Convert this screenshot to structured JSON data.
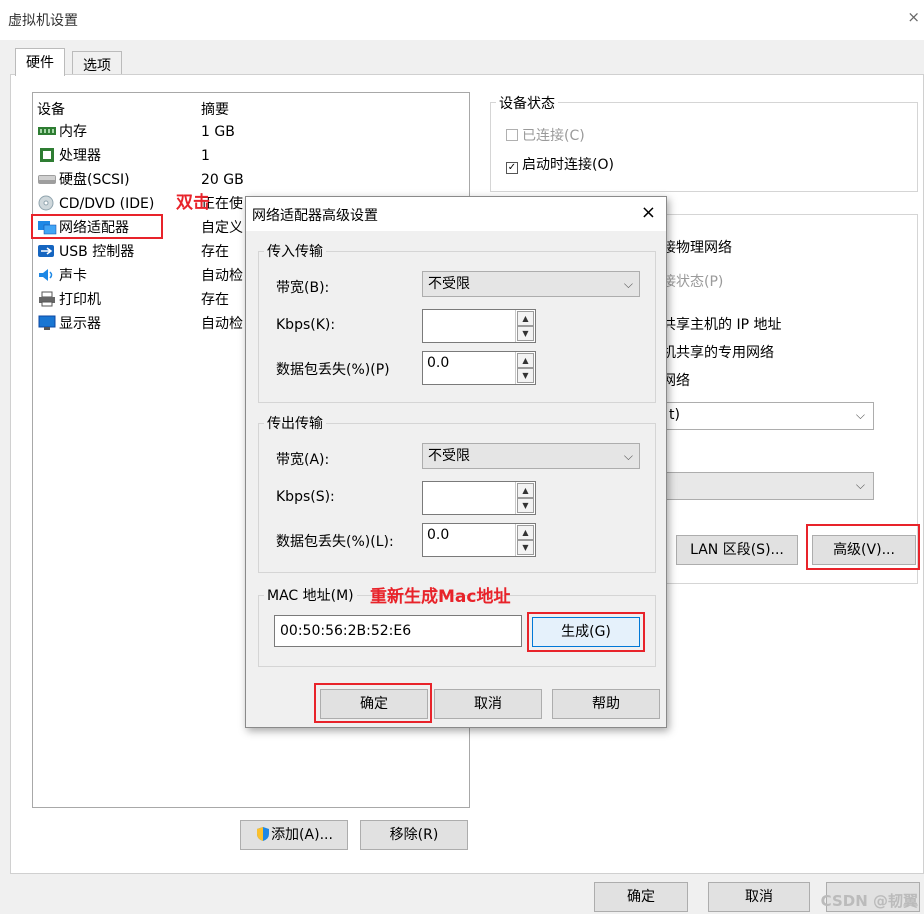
{
  "window": {
    "title": "虚拟机设置",
    "close_glyph": "×"
  },
  "tabs": [
    {
      "label": "硬件",
      "active": true
    },
    {
      "label": "选项",
      "active": false
    }
  ],
  "device_list": {
    "col_device": "设备",
    "col_summary": "摘要",
    "items": [
      {
        "name": "内存",
        "summary": "1 GB",
        "icon": "memory-icon"
      },
      {
        "name": "处理器",
        "summary": "1",
        "icon": "cpu-icon"
      },
      {
        "name": "硬盘(SCSI)",
        "summary": "20 GB",
        "icon": "harddisk-icon"
      },
      {
        "name": "CD/DVD (IDE)",
        "summary": "正在使",
        "icon": "cdrom-icon"
      },
      {
        "name": "网络适配器",
        "summary": "自定义",
        "icon": "network-icon"
      },
      {
        "name": "USB 控制器",
        "summary": "存在",
        "icon": "usb-icon"
      },
      {
        "name": "声卡",
        "summary": "自动检",
        "icon": "sound-icon"
      },
      {
        "name": "打印机",
        "summary": "存在",
        "icon": "printer-icon"
      },
      {
        "name": "显示器",
        "summary": "自动检",
        "icon": "display-icon"
      }
    ],
    "add_button": "添加(A)...",
    "remove_button": "移除(R)"
  },
  "device_status": {
    "title": "设备状态",
    "connected": "已连接(C)",
    "connect_at_power_on": "启动时连接(O)"
  },
  "network_connection_partial": {
    "bridged": "接物理网络",
    "replicate": "接状态(P)",
    "nat": "共享主机的 IP 地址",
    "host_only": "机共享的专用网络",
    "custom": "网络",
    "custom_combo": "t)",
    "lan_segment_button": "LAN 区段(S)...",
    "advanced_button": "高级(V)..."
  },
  "annotations": {
    "double_click": "双击",
    "regenerate_mac": "重新生成Mac地址"
  },
  "dialog": {
    "title": "网络适配器高级设置",
    "close_glyph": "×",
    "incoming": {
      "group": "传入传输",
      "bandwidth_label": "带宽(B):",
      "bandwidth_value": "不受限",
      "kbps_label": "Kbps(K):",
      "kbps_value": "",
      "loss_label": "数据包丢失(%)(P)",
      "loss_value": "0.0"
    },
    "outgoing": {
      "group": "传出传输",
      "bandwidth_label": "带宽(A):",
      "bandwidth_value": "不受限",
      "kbps_label": "Kbps(S):",
      "kbps_value": "",
      "loss_label": "数据包丢失(%)(L):",
      "loss_value": "0.0"
    },
    "mac_label": "MAC 地址(M)",
    "mac_value": "00:50:56:2B:52:E6",
    "generate_button": "生成(G)",
    "ok_button": "确定",
    "cancel_button": "取消",
    "help_button": "帮助"
  },
  "footer": {
    "ok_button": "确定",
    "cancel_button": "取消",
    "watermark": "CSDN @韧翼"
  },
  "colors": {
    "annotation_red": "#e8232a",
    "focus_blue": "#0078d7"
  }
}
